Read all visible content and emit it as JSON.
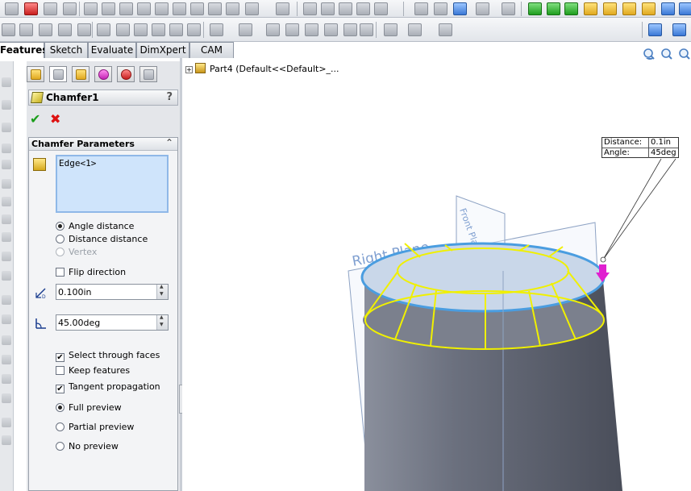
{
  "command_manager": {
    "tabs": [
      {
        "label": "Features",
        "active": true
      },
      {
        "label": "Sketch"
      },
      {
        "label": "Evaluate"
      },
      {
        "label": "DimXpert"
      },
      {
        "label": "CAM"
      }
    ]
  },
  "property_manager": {
    "title": "Chamfer1",
    "help": "?",
    "ok_glyph": "✔",
    "cancel_glyph": "✖",
    "group_title": "Chamfer Parameters",
    "collapse_glyph": "⌃",
    "selection": "Edge<1>",
    "mode_options": [
      {
        "label": "Angle distance",
        "selected": true,
        "enabled": true
      },
      {
        "label": "Distance distance",
        "selected": false,
        "enabled": true
      },
      {
        "label": "Vertex",
        "selected": false,
        "enabled": false
      }
    ],
    "flip_direction": {
      "label": "Flip direction",
      "checked": false
    },
    "distance": "0.100in",
    "angle": "45.00deg",
    "checks": [
      {
        "label": "Select through faces",
        "checked": true
      },
      {
        "label": "Keep features",
        "checked": false
      },
      {
        "label": "Tangent propagation",
        "checked": true
      }
    ],
    "previews": [
      {
        "label": "Full preview",
        "selected": true
      },
      {
        "label": "Partial preview",
        "selected": false
      },
      {
        "label": "No preview",
        "selected": false
      }
    ]
  },
  "graphics": {
    "tree_root": "Part4  (Default<<Default>_...",
    "callout": {
      "distance_label": "Distance:",
      "distance_value": "0.1in",
      "angle_label": "Angle:",
      "angle_value": "45deg"
    },
    "right_plane_label": "Right Plane",
    "front_plane_label": "Front Plane"
  },
  "colors": {
    "cylinder": "#6b707e",
    "highlight_edge": "#4a9de0",
    "preview_lines": "#f0f000",
    "handle": "#e020d0",
    "plane_label": "#7f9fd0"
  }
}
